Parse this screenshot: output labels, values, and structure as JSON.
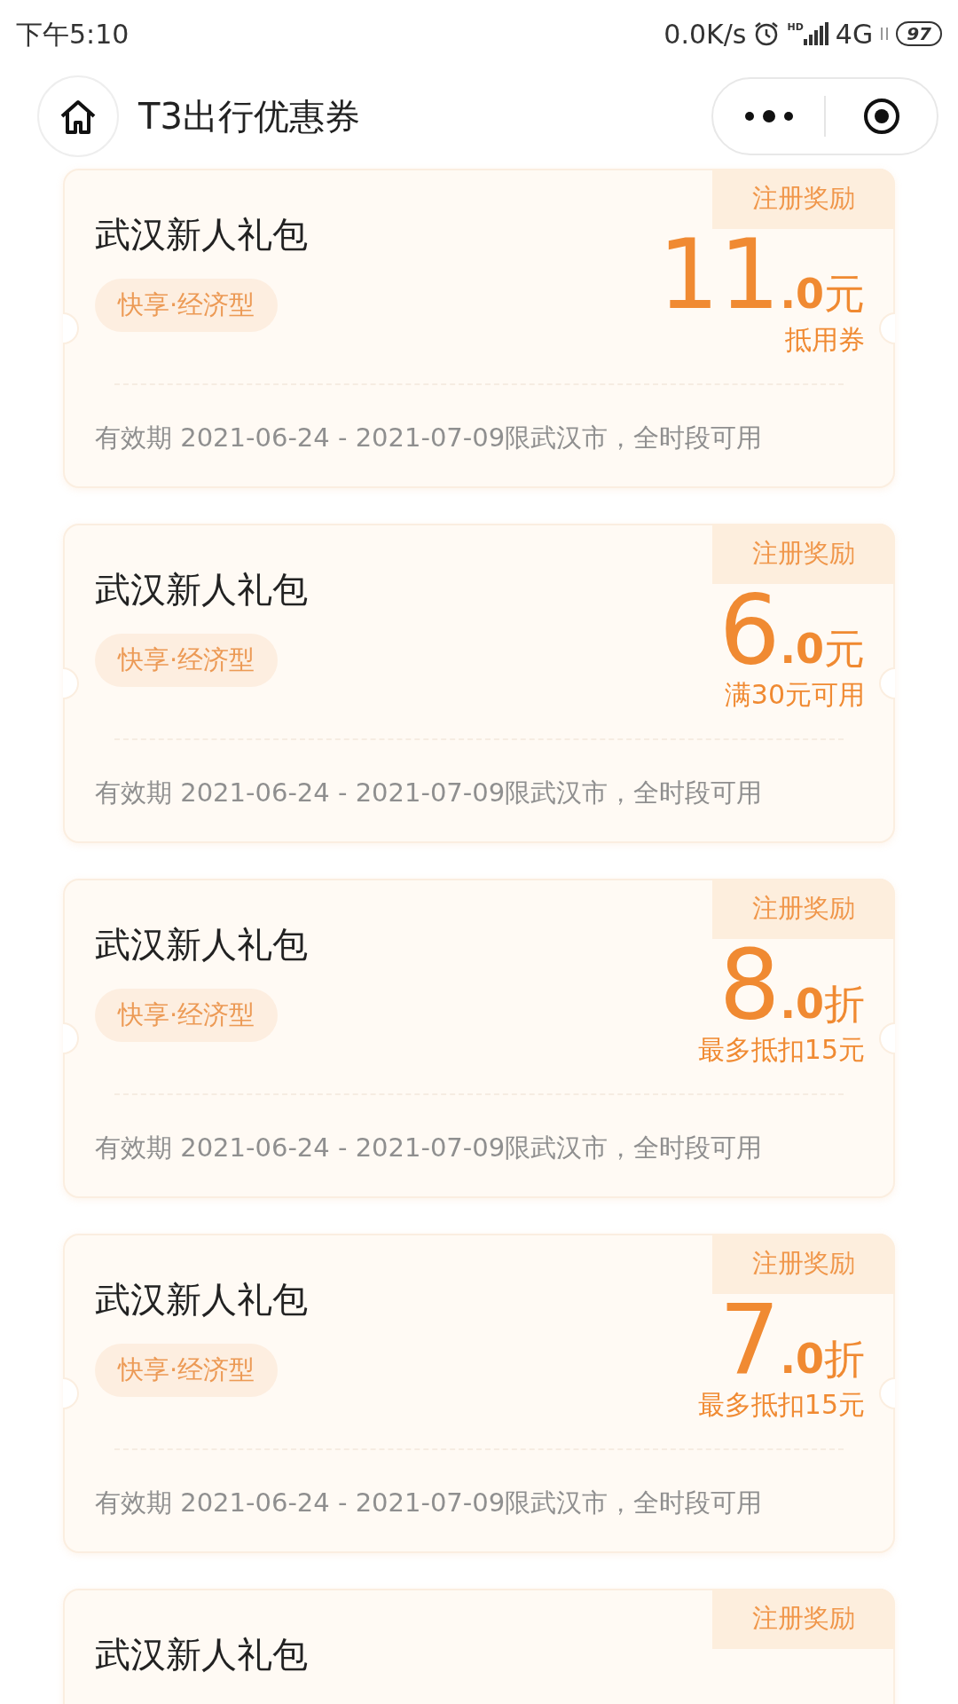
{
  "status_bar": {
    "time": "下午5:10",
    "speed": "0.0K/s",
    "hd": "HD",
    "network": "4G",
    "battery": "97"
  },
  "header": {
    "title": "T3出行优惠券"
  },
  "coupons": [
    {
      "title": "武汉新人礼包",
      "tag": "快享·经济型",
      "badge": "注册奖励",
      "amount": {
        "integer": "11",
        "decimal": ".0",
        "unit": "元",
        "note": "抵用券"
      },
      "validity": "有效期 2021-06-24 - 2021-07-09限武汉市，全时段可用"
    },
    {
      "title": "武汉新人礼包",
      "tag": "快享·经济型",
      "badge": "注册奖励",
      "amount": {
        "integer": "6",
        "decimal": ".0",
        "unit": "元",
        "note": "满30元可用"
      },
      "validity": "有效期 2021-06-24 - 2021-07-09限武汉市，全时段可用"
    },
    {
      "title": "武汉新人礼包",
      "tag": "快享·经济型",
      "badge": "注册奖励",
      "amount": {
        "integer": "8",
        "decimal": ".0",
        "unit": "折",
        "note": "最多抵扣15元"
      },
      "validity": "有效期 2021-06-24 - 2021-07-09限武汉市，全时段可用"
    },
    {
      "title": "武汉新人礼包",
      "tag": "快享·经济型",
      "badge": "注册奖励",
      "amount": {
        "integer": "7",
        "decimal": ".0",
        "unit": "折",
        "note": "最多抵扣15元"
      },
      "validity": "有效期 2021-06-24 - 2021-07-09限武汉市，全时段可用"
    },
    {
      "title": "武汉新人礼包",
      "badge": "注册奖励"
    }
  ]
}
